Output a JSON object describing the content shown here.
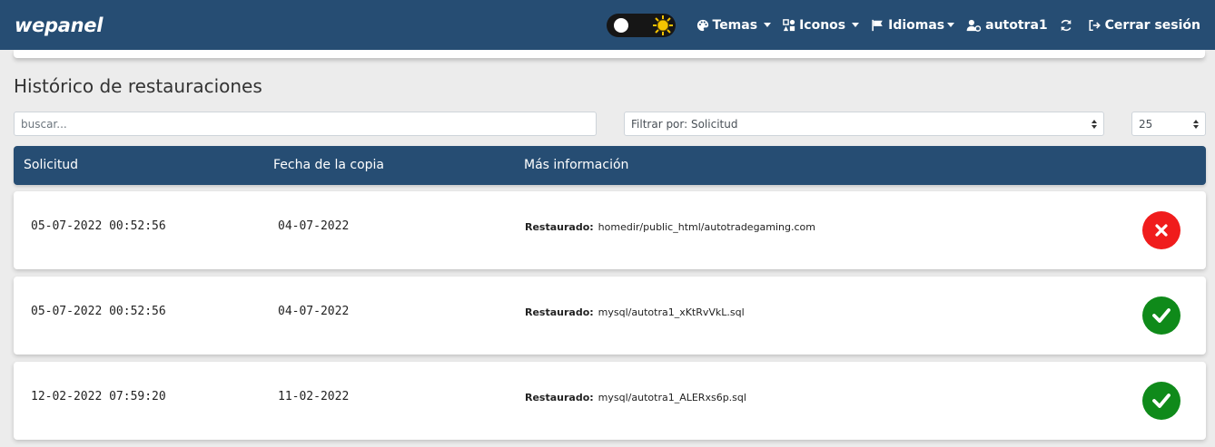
{
  "brand": "wepanel",
  "nav": {
    "temas": "Temas",
    "iconos": "Iconos",
    "idiomas": "Idiomas",
    "user": "autotra1",
    "logout": "Cerrar sesión"
  },
  "page": {
    "title": "Histórico de restauraciones"
  },
  "controls": {
    "search_placeholder": "buscar...",
    "filter_value": "Filtrar por: Solicitud",
    "page_size": "25"
  },
  "table": {
    "headers": [
      "Solicitud",
      "Fecha de la copia",
      "Más información"
    ],
    "info_label": "Restaurado:",
    "rows": [
      {
        "solicitud": "05-07-2022 00:52:56",
        "fecha": "04-07-2022",
        "info": "homedir/public_html/autotradegaming.com",
        "status": "error"
      },
      {
        "solicitud": "05-07-2022 00:52:56",
        "fecha": "04-07-2022",
        "info": "mysql/autotra1_xKtRvVkL.sql",
        "status": "ok"
      },
      {
        "solicitud": "12-02-2022 07:59:20",
        "fecha": "11-02-2022",
        "info": "mysql/autotra1_ALERxs6p.sql",
        "status": "ok"
      }
    ]
  },
  "colors": {
    "navbar": "#264d73",
    "error": "#f01c1c",
    "ok": "#0f8a1a"
  }
}
